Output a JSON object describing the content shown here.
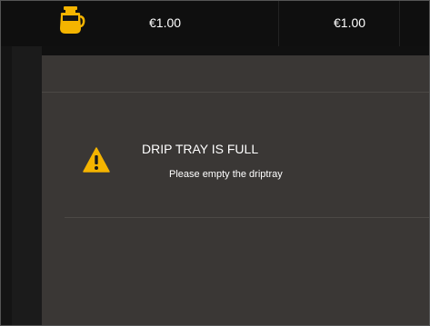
{
  "header": {
    "prices": [
      "€1.00",
      "€1.00"
    ]
  },
  "icons": {
    "coffee_pot": "coffee-pot-icon",
    "warning": "warning-icon"
  },
  "colors": {
    "accent": "#f4b400",
    "dialog_background": "#3a3735"
  },
  "alert": {
    "title": "DRIP TRAY IS FULL",
    "message": "Please empty the driptray"
  }
}
